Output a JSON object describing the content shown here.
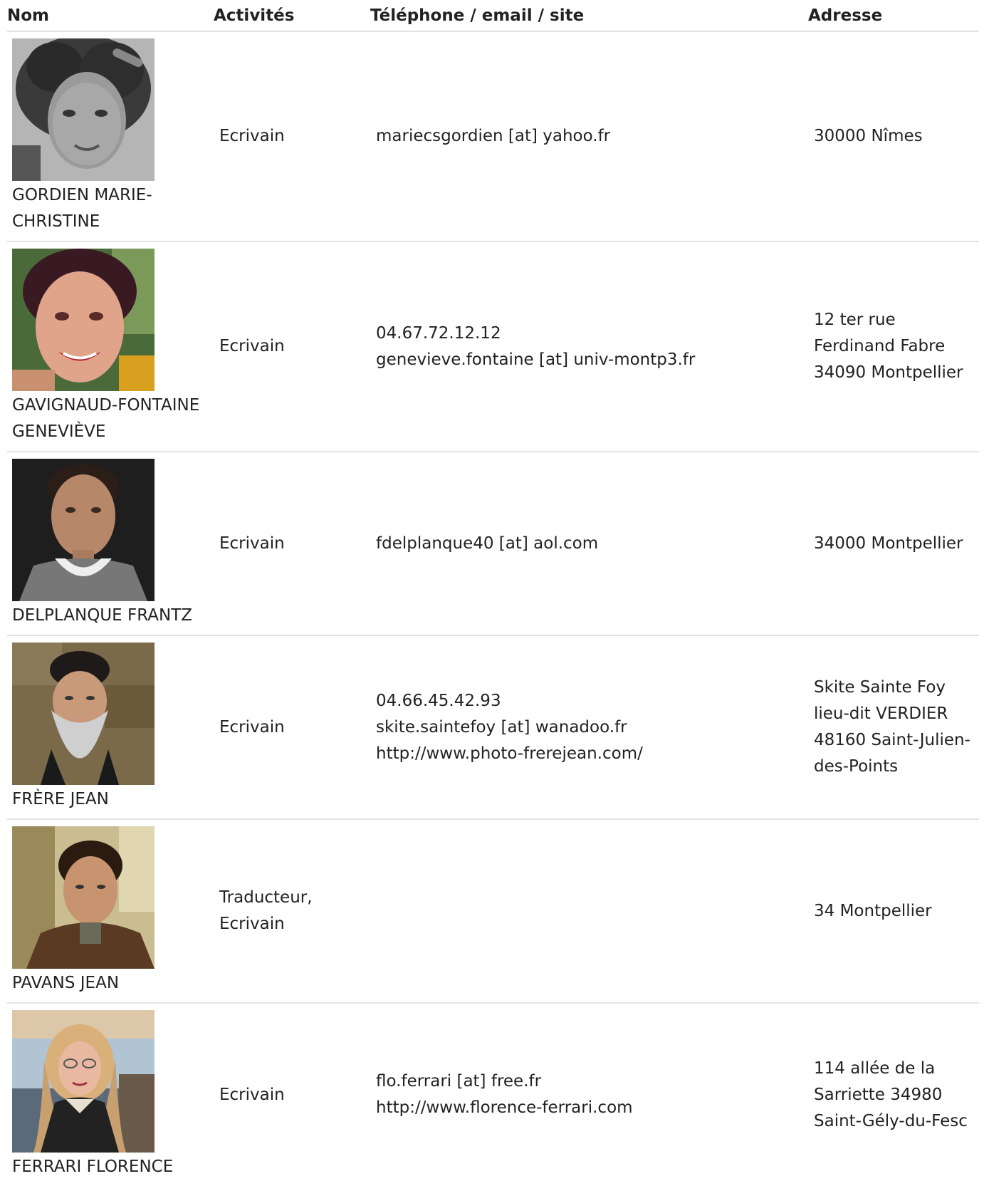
{
  "table": {
    "headers": {
      "nom": "Nom",
      "activites": "Activités",
      "contact": "Téléphone / email / site",
      "adresse": "Adresse"
    },
    "rows": [
      {
        "name": "GORDIEN MARIE-CHRISTINE",
        "activity": "Ecrivain",
        "contact": [
          "mariecsgordien [at] yahoo.fr"
        ],
        "address": "30000 Nîmes"
      },
      {
        "name": "GAVIGNAUD-FONTAINE GENEVIÈVE",
        "activity": "Ecrivain",
        "contact": [
          "04.67.72.12.12",
          "genevieve.fontaine [at] univ-montp3.fr"
        ],
        "address": "12 ter rue Ferdinand Fabre 34090 Montpellier"
      },
      {
        "name": "DELPLANQUE FRANTZ",
        "activity": "Ecrivain",
        "contact": [
          "fdelplanque40 [at] aol.com"
        ],
        "address": "34000 Montpellier"
      },
      {
        "name": "FRÈRE JEAN",
        "activity": "Ecrivain",
        "contact": [
          "04.66.45.42.93",
          "skite.saintefoy [at] wanadoo.fr",
          "http://www.photo-frerejean.com/"
        ],
        "address": "Skite Sainte Foy lieu-dit VERDIER 48160 Saint-Julien-des-Points"
      },
      {
        "name": "PAVANS JEAN",
        "activity": "Traducteur, Ecrivain",
        "contact": [],
        "address": "34 Montpellier"
      },
      {
        "name": "FERRARI FLORENCE",
        "activity": "Ecrivain",
        "contact": [
          "flo.ferrari [at] free.fr",
          "http://www.florence-ferrari.com"
        ],
        "address": "114 allée de la Sarriette 34980 Saint-Gély-du-Fesc"
      }
    ]
  }
}
